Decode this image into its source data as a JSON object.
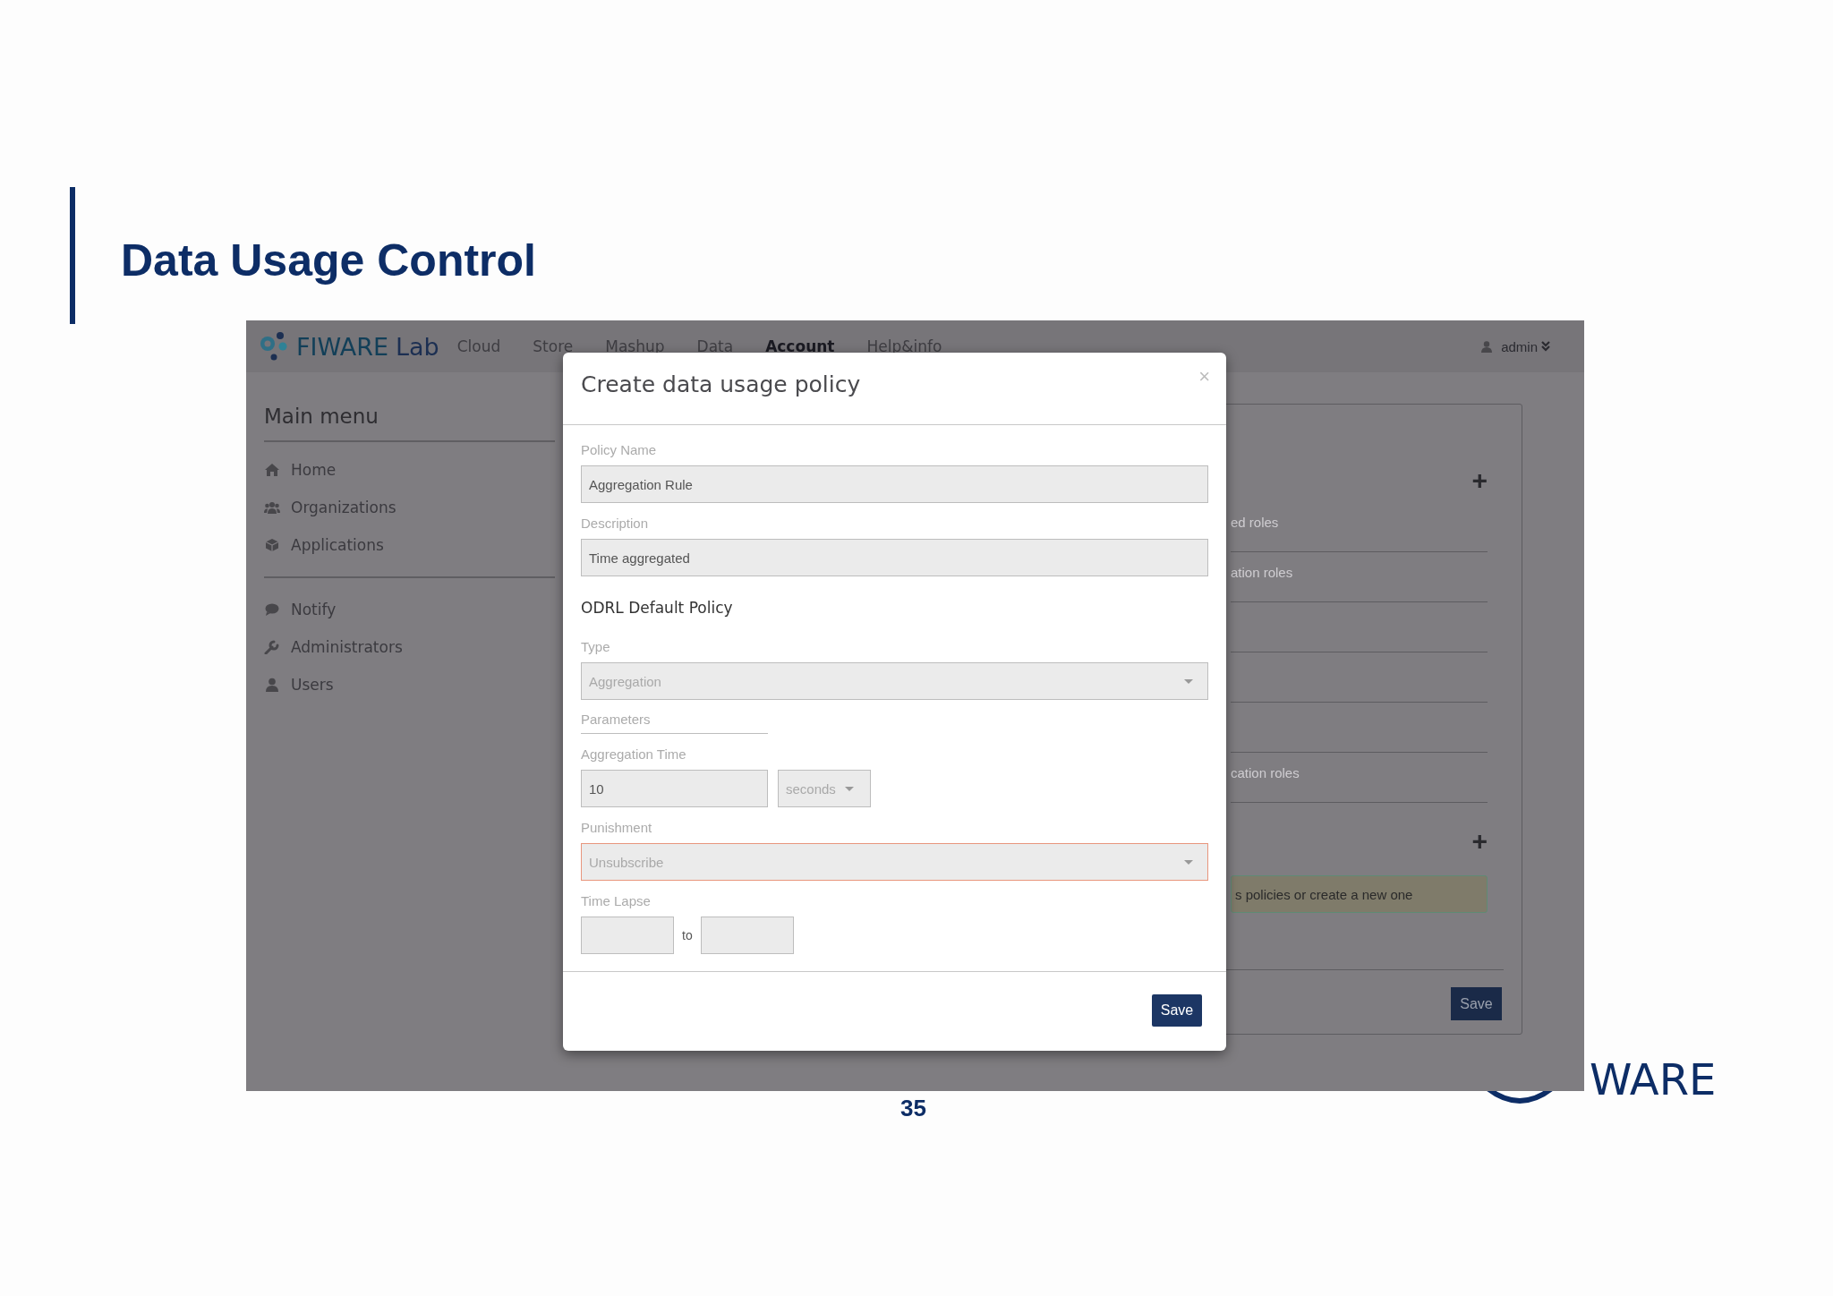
{
  "slide": {
    "title": "Data Usage Control",
    "page_number": "35",
    "logo_text": "WARE"
  },
  "app": {
    "brand": {
      "name": "FIWARE",
      "suffix": "Lab"
    },
    "nav": [
      {
        "label": "Cloud",
        "selected": false
      },
      {
        "label": "Store",
        "selected": false
      },
      {
        "label": "Mashup",
        "selected": false
      },
      {
        "label": "Data",
        "selected": false
      },
      {
        "label": "Account",
        "selected": true
      },
      {
        "label": "Help&info",
        "selected": false
      }
    ],
    "user": "admin",
    "sidebar": {
      "title": "Main menu",
      "groups": [
        [
          {
            "label": "Home"
          },
          {
            "label": "Organizations"
          },
          {
            "label": "Applications"
          }
        ],
        [
          {
            "label": "Notify"
          },
          {
            "label": "Administrators"
          },
          {
            "label": "Users"
          }
        ]
      ]
    },
    "panel": {
      "add_buttons": [
        "+",
        "+"
      ],
      "rows": [
        {
          "kind": "text",
          "label": "ed roles"
        },
        {
          "kind": "text",
          "label": "ation roles"
        },
        {
          "kind": "blank"
        },
        {
          "kind": "blank"
        },
        {
          "kind": "blank"
        },
        {
          "kind": "text",
          "label": "cation roles"
        }
      ],
      "alert": "s policies or create a new one",
      "save": "Save"
    }
  },
  "modal": {
    "title": "Create data usage policy",
    "close": "×",
    "policy_name": {
      "label": "Policy Name",
      "value": "Aggregation Rule"
    },
    "description": {
      "label": "Description",
      "value": "Time aggregated"
    },
    "section_title": "ODRL Default Policy",
    "type": {
      "label": "Type",
      "value": "Aggregation"
    },
    "parameters": "Parameters",
    "aggregation_time": {
      "label": "Aggregation Time",
      "value": "10",
      "unit": "seconds"
    },
    "punishment": {
      "label": "Punishment",
      "value": "Unsubscribe",
      "invalid": true
    },
    "time_lapse": {
      "label": "Time Lapse",
      "separator": "to"
    },
    "save": "Save"
  }
}
